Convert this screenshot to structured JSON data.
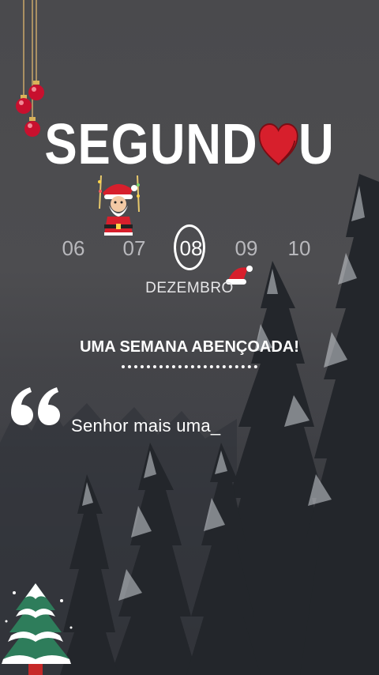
{
  "title": {
    "text_left": "SEGUND",
    "text_right": "U"
  },
  "dates": {
    "items": [
      "06",
      "07",
      "08",
      "09",
      "10"
    ],
    "selected": "08"
  },
  "month": "DEZEMBRO",
  "subtitle": "UMA SEMANA ABENÇOADA!",
  "body_text": "Senhor mais uma_",
  "colors": {
    "heart": "#d71f2c",
    "text": "#ffffff",
    "date_inactive": "#b8b8bc",
    "background_top": "#4a4a4d",
    "background_bottom": "#1e2025"
  },
  "icons": [
    "ornament-icon",
    "heart-icon",
    "santa-icon",
    "santa-hat-icon",
    "quote-icon",
    "christmas-tree-icon"
  ]
}
